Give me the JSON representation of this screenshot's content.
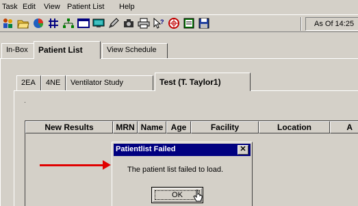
{
  "menu": {
    "items": [
      {
        "label": "Task"
      },
      {
        "label": "Edit"
      },
      {
        "label": "View"
      },
      {
        "label": "Patient List"
      },
      {
        "label": "Help"
      }
    ]
  },
  "toolbar": {
    "icons": [
      "people-icon",
      "folder-open-icon",
      "chart-icon",
      "grid-icon",
      "hierarchy-icon",
      "window-icon",
      "monitor-icon",
      "pen-icon",
      "camera-icon",
      "printer-icon",
      "help-pointer-icon",
      "globe-icon",
      "notes-icon",
      "save-icon"
    ],
    "as_of_label": "As Of 14:25"
  },
  "outer_tabs": [
    {
      "label": "In-Box"
    },
    {
      "label": "Patient List"
    },
    {
      "label": "View Schedule"
    }
  ],
  "inner_tabs": [
    {
      "label": "2EA"
    },
    {
      "label": "4NE"
    },
    {
      "label": "Ventilator Study"
    },
    {
      "label": "Test (T. Taylor1)"
    }
  ],
  "columns": [
    {
      "label": "New Results"
    },
    {
      "label": "MRN"
    },
    {
      "label": "Name"
    },
    {
      "label": "Age"
    },
    {
      "label": "Facility"
    },
    {
      "label": "Location"
    },
    {
      "label": "A"
    }
  ],
  "dialog": {
    "title": "Patientlist Failed",
    "close_glyph": "✕",
    "message": "The patient list failed to load.",
    "ok_label": "OK"
  },
  "colors": {
    "title_bar": "#000080",
    "arrow": "#e00000",
    "chrome": "#d4d0c8"
  }
}
